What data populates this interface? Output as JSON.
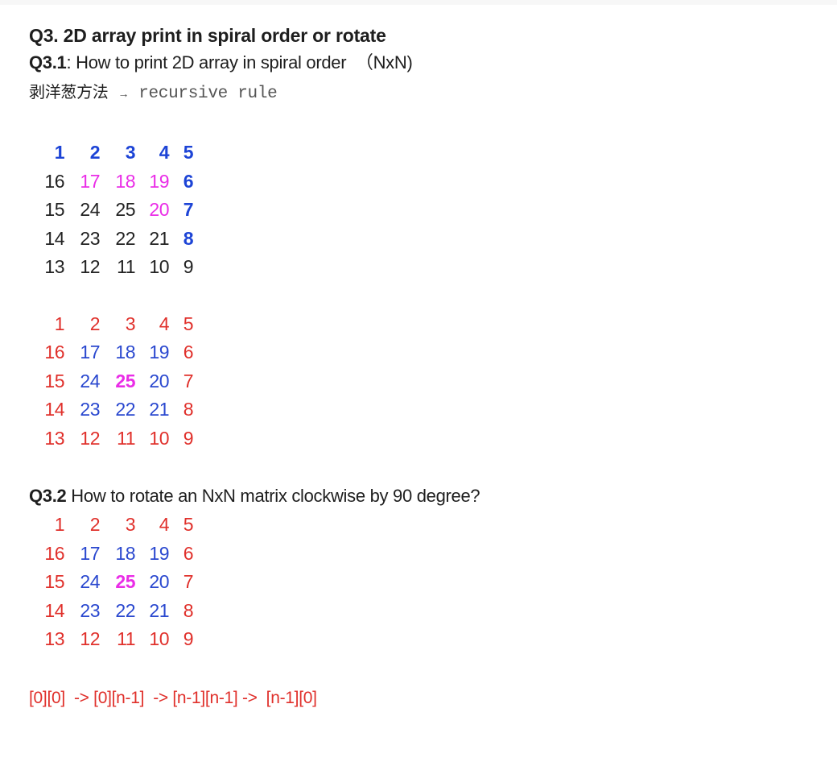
{
  "title": "Q3.  2D array print in spiral order or rotate",
  "q31": {
    "label": "Q3.1",
    "text": ": How to print 2D array in spiral order  （NxN)"
  },
  "approach": {
    "cn_text": "剥洋葱方法",
    "arrow": "→",
    "code": "recursive rule"
  },
  "matrix1": [
    [
      "1",
      "2",
      "3",
      "4",
      "5"
    ],
    [
      "16",
      "17",
      "18",
      "19",
      "6"
    ],
    [
      "15",
      "24",
      "25",
      "20",
      "7"
    ],
    [
      "14",
      "23",
      "22",
      "21",
      "8"
    ],
    [
      "13",
      "12",
      "11",
      "10",
      "9"
    ]
  ],
  "matrix2": [
    [
      "1",
      "2",
      "3",
      "4",
      "5"
    ],
    [
      "16",
      "17",
      "18",
      "19",
      "6"
    ],
    [
      "15",
      "24",
      "25",
      "20",
      "7"
    ],
    [
      "14",
      "23",
      "22",
      "21",
      "8"
    ],
    [
      "13",
      "12",
      "11",
      "10",
      "9"
    ]
  ],
  "q32": {
    "label": "Q3.2",
    "text": " How to rotate an NxN matrix clockwise by 90 degree?"
  },
  "matrix3": [
    [
      "1",
      "2",
      "3",
      "4",
      "5"
    ],
    [
      "16",
      "17",
      "18",
      "19",
      "6"
    ],
    [
      "15",
      "24",
      "25",
      "20",
      "7"
    ],
    [
      "14",
      "23",
      "22",
      "21",
      "8"
    ],
    [
      "13",
      "12",
      "11",
      "10",
      "9"
    ]
  ],
  "formula": "[0][0]  -> [0][n-1]  -> [n-1][n-1] ->  [n-1][0]",
  "colors": {
    "blue": "#1d44d6",
    "magenta": "#ea2de7",
    "red": "#e0302b",
    "black": "#222222"
  }
}
